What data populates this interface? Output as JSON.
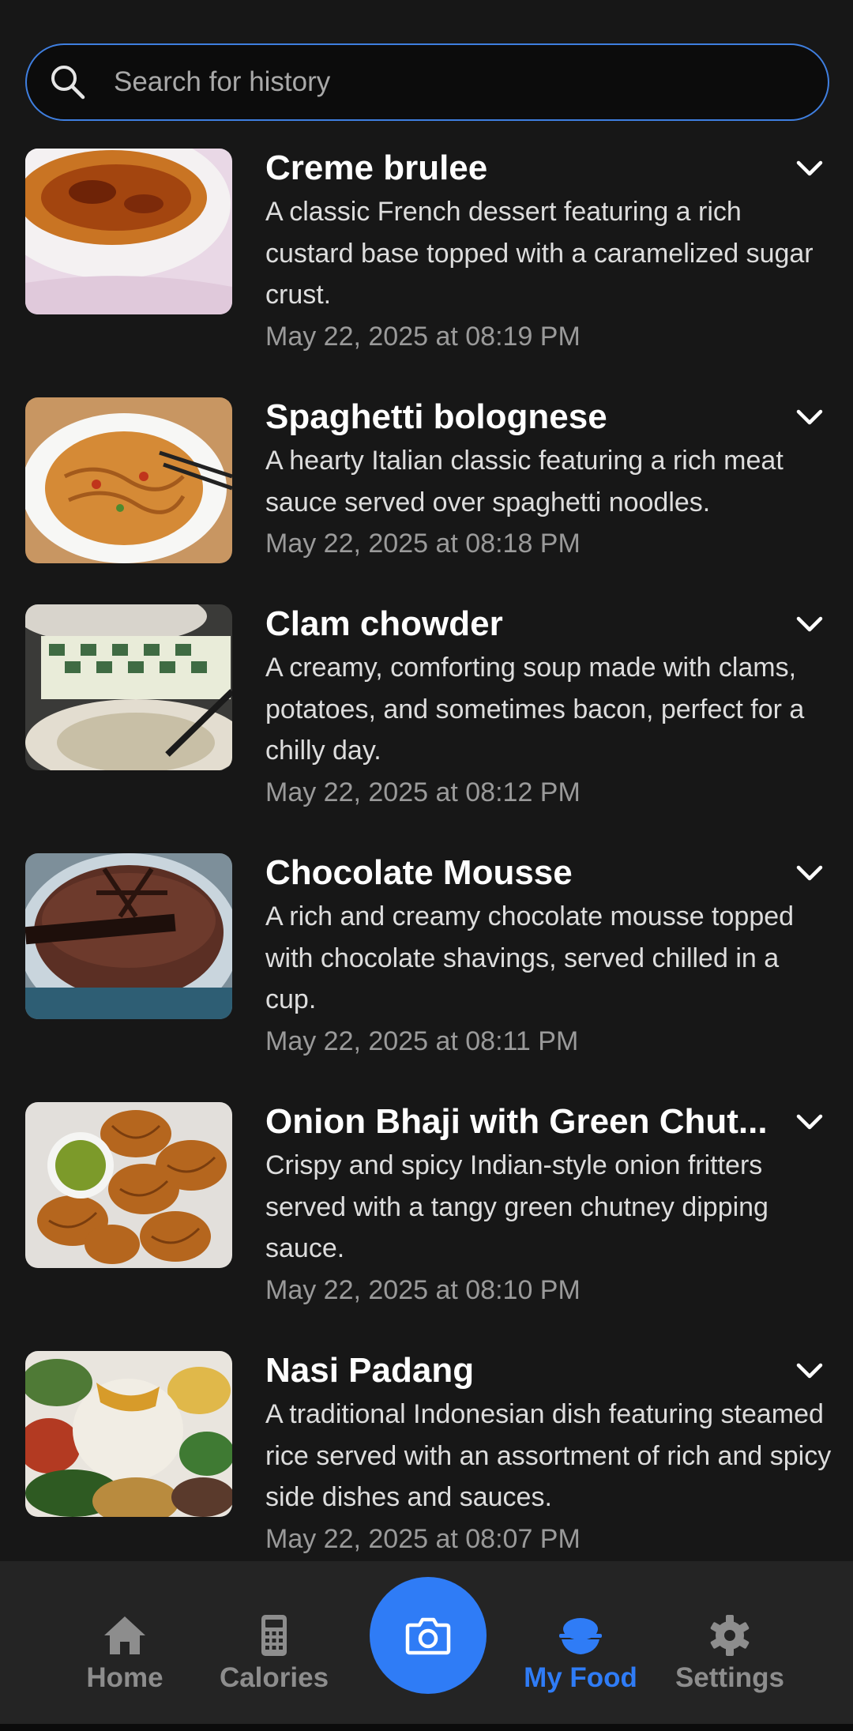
{
  "search": {
    "placeholder": "Search for history",
    "value": ""
  },
  "items": [
    {
      "title": "Creme brulee",
      "description": "A classic French dessert featuring a rich custard base topped with a caramelized sugar crust.",
      "date": "May 22, 2025 at 08:19 PM"
    },
    {
      "title": "Spaghetti bolognese",
      "description": "A hearty Italian classic featuring a rich meat sauce served over spaghetti noodles.",
      "date": "May 22, 2025 at 08:18 PM"
    },
    {
      "title": "Clam chowder",
      "description": "A creamy, comforting soup made with clams, potatoes, and sometimes bacon, perfect for a chilly day.",
      "date": "May 22, 2025 at 08:12 PM"
    },
    {
      "title": "Chocolate Mousse",
      "description": "A rich and creamy chocolate mousse topped with chocolate shavings, served chilled in a cup.",
      "date": "May 22, 2025 at 08:11 PM"
    },
    {
      "title": "Onion Bhaji with Green Chut...",
      "description": "Crispy and spicy Indian-style onion fritters served with a tangy green chutney dipping sauce.",
      "date": "May 22, 2025 at 08:10 PM"
    },
    {
      "title": "Nasi Padang",
      "description": "A traditional Indonesian dish featuring steamed rice served with an assortment of rich and spicy side dishes and sauces.",
      "date": "May 22, 2025 at 08:07 PM"
    }
  ],
  "nav": {
    "home": "Home",
    "calories": "Calories",
    "camera_icon": "camera-icon",
    "my_food": "My Food",
    "settings": "Settings",
    "active": "my_food"
  },
  "colors": {
    "accent": "#2f7cf6",
    "background": "#171717",
    "nav_background": "#242424"
  }
}
